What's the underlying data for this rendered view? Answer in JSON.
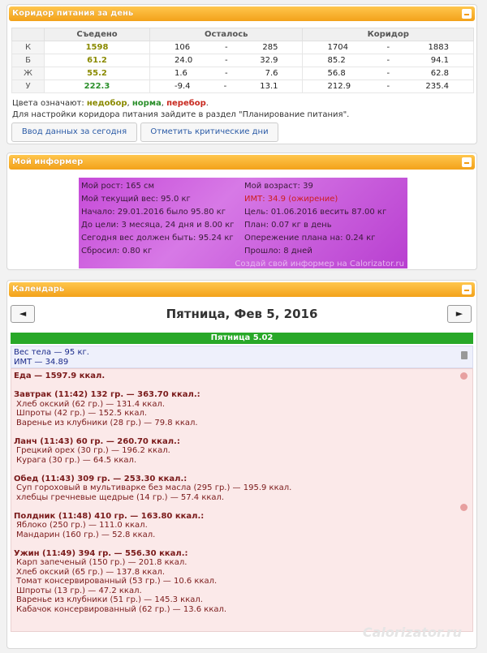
{
  "corridor": {
    "title": "Коридор питания за день",
    "headers": [
      "",
      "Съедено",
      "Осталось",
      "Коридор"
    ],
    "rows": [
      {
        "label": "К",
        "eaten": "1598",
        "left_min": "106",
        "left_dash": "-",
        "left_max": "285",
        "corr_min": "1704",
        "corr_dash": "-",
        "corr_max": "1883"
      },
      {
        "label": "Б",
        "eaten": "61.2",
        "left_min": "24.0",
        "left_dash": "-",
        "left_max": "32.9",
        "corr_min": "85.2",
        "corr_dash": "-",
        "corr_max": "94.1"
      },
      {
        "label": "Ж",
        "eaten": "55.2",
        "left_min": "1.6",
        "left_dash": "-",
        "left_max": "7.6",
        "corr_min": "56.8",
        "corr_dash": "-",
        "corr_max": "62.8"
      },
      {
        "label": "У",
        "eaten": "222.3",
        "left_min": "-9.4",
        "left_dash": "-",
        "left_max": "13.1",
        "corr_min": "212.9",
        "corr_dash": "-",
        "corr_max": "235.4"
      }
    ],
    "legend_prefix": "Цвета означают: ",
    "legend_under": "недобор",
    "legend_sep1": ", ",
    "legend_norm": "норма",
    "legend_sep2": ", ",
    "legend_over": "перебор",
    "legend_end": ".",
    "hint": "Для настройки коридора питания зайдите в раздел \"Планирование питания\".",
    "btn_today": "Ввод данных за сегодня",
    "btn_critical": "Отметить критические дни"
  },
  "informer": {
    "title": "Мой информер",
    "left": [
      "Мой рост: 165 см",
      "Мой текущий вес: 95.0 кг",
      "Начало: 29.01.2016 было 95.80 кг",
      "До цели: 3 месяца, 24 дня и 8.00 кг",
      "Сегодня вес должен быть: 95.24 кг",
      "Сбросил: 0.80 кг"
    ],
    "right": [
      "Мой возраст: 39",
      "ИМТ: 34.9 (ожирение)",
      "Цель: 01.06.2016 весить 87.00 кг",
      "План: 0.07 кг в день",
      "Опережение плана на: 0.24 кг",
      "Прошло: 8 дней"
    ],
    "link": "Создай свой информер на Calorizator.ru"
  },
  "calendar": {
    "title": "Календарь",
    "prev": "◄",
    "next": "►",
    "date": "Пятница, Фев 5, 2016",
    "day_header": "Пятница 5.02",
    "weight_line": "Вес тела — 95 кг.",
    "bmi_line": "ИМТ — 34.89",
    "food": [
      {
        "type": "meal",
        "text": "Еда — 1597.9 ккал."
      },
      {
        "type": "gap",
        "text": ""
      },
      {
        "type": "meal",
        "text": "Завтрак (11:42) 132 гр. — 363.70 ккал.:"
      },
      {
        "type": "item",
        "text": "Хлеб окский (62 гр.) — 131.4 ккал."
      },
      {
        "type": "item",
        "text": "Шпроты (42 гр.) — 152.5 ккал."
      },
      {
        "type": "item",
        "text": "Варенье из клубники (28 гр.) — 79.8 ккал."
      },
      {
        "type": "gap",
        "text": ""
      },
      {
        "type": "meal",
        "text": "Ланч (11:43) 60 гр. — 260.70 ккал.:"
      },
      {
        "type": "item",
        "text": "Грецкий орех (30 гр.) — 196.2 ккал."
      },
      {
        "type": "item",
        "text": "Курага (30 гр.) — 64.5 ккал."
      },
      {
        "type": "gap",
        "text": ""
      },
      {
        "type": "meal",
        "text": "Обед (11:43) 309 гр. — 253.30 ккал.:"
      },
      {
        "type": "item",
        "text": "Суп гороховый в мультиварке без масла (295 гр.) — 195.9 ккал."
      },
      {
        "type": "item",
        "text": "хлебцы гречневые щедрые (14 гр.) — 57.4 ккал."
      },
      {
        "type": "gap",
        "text": ""
      },
      {
        "type": "meal",
        "text": "Полдник (11:48) 410 гр. — 163.80 ккал.:"
      },
      {
        "type": "item",
        "text": "Яблоко (250 гр.) — 111.0 ккал."
      },
      {
        "type": "item",
        "text": "Мандарин (160 гр.) — 52.8 ккал."
      },
      {
        "type": "gap",
        "text": ""
      },
      {
        "type": "meal",
        "text": "Ужин (11:49) 394 гр. — 556.30 ккал.:"
      },
      {
        "type": "item",
        "text": "Карп запеченый (150 гр.) — 201.8 ккал."
      },
      {
        "type": "item",
        "text": "Хлеб окский (65 гр.) — 137.8 ккал."
      },
      {
        "type": "item",
        "text": "Томат консервированный (53 гр.) — 10.6 ккал."
      },
      {
        "type": "item",
        "text": "Шпроты (13 гр.) — 47.2 ккал."
      },
      {
        "type": "item",
        "text": "Варенье из клубники (51 гр.) — 145.3 ккал."
      },
      {
        "type": "item",
        "text": "Кабачок консервированный (62 гр.) — 13.6 ккал."
      }
    ],
    "brand": "Calorizator.ru"
  }
}
